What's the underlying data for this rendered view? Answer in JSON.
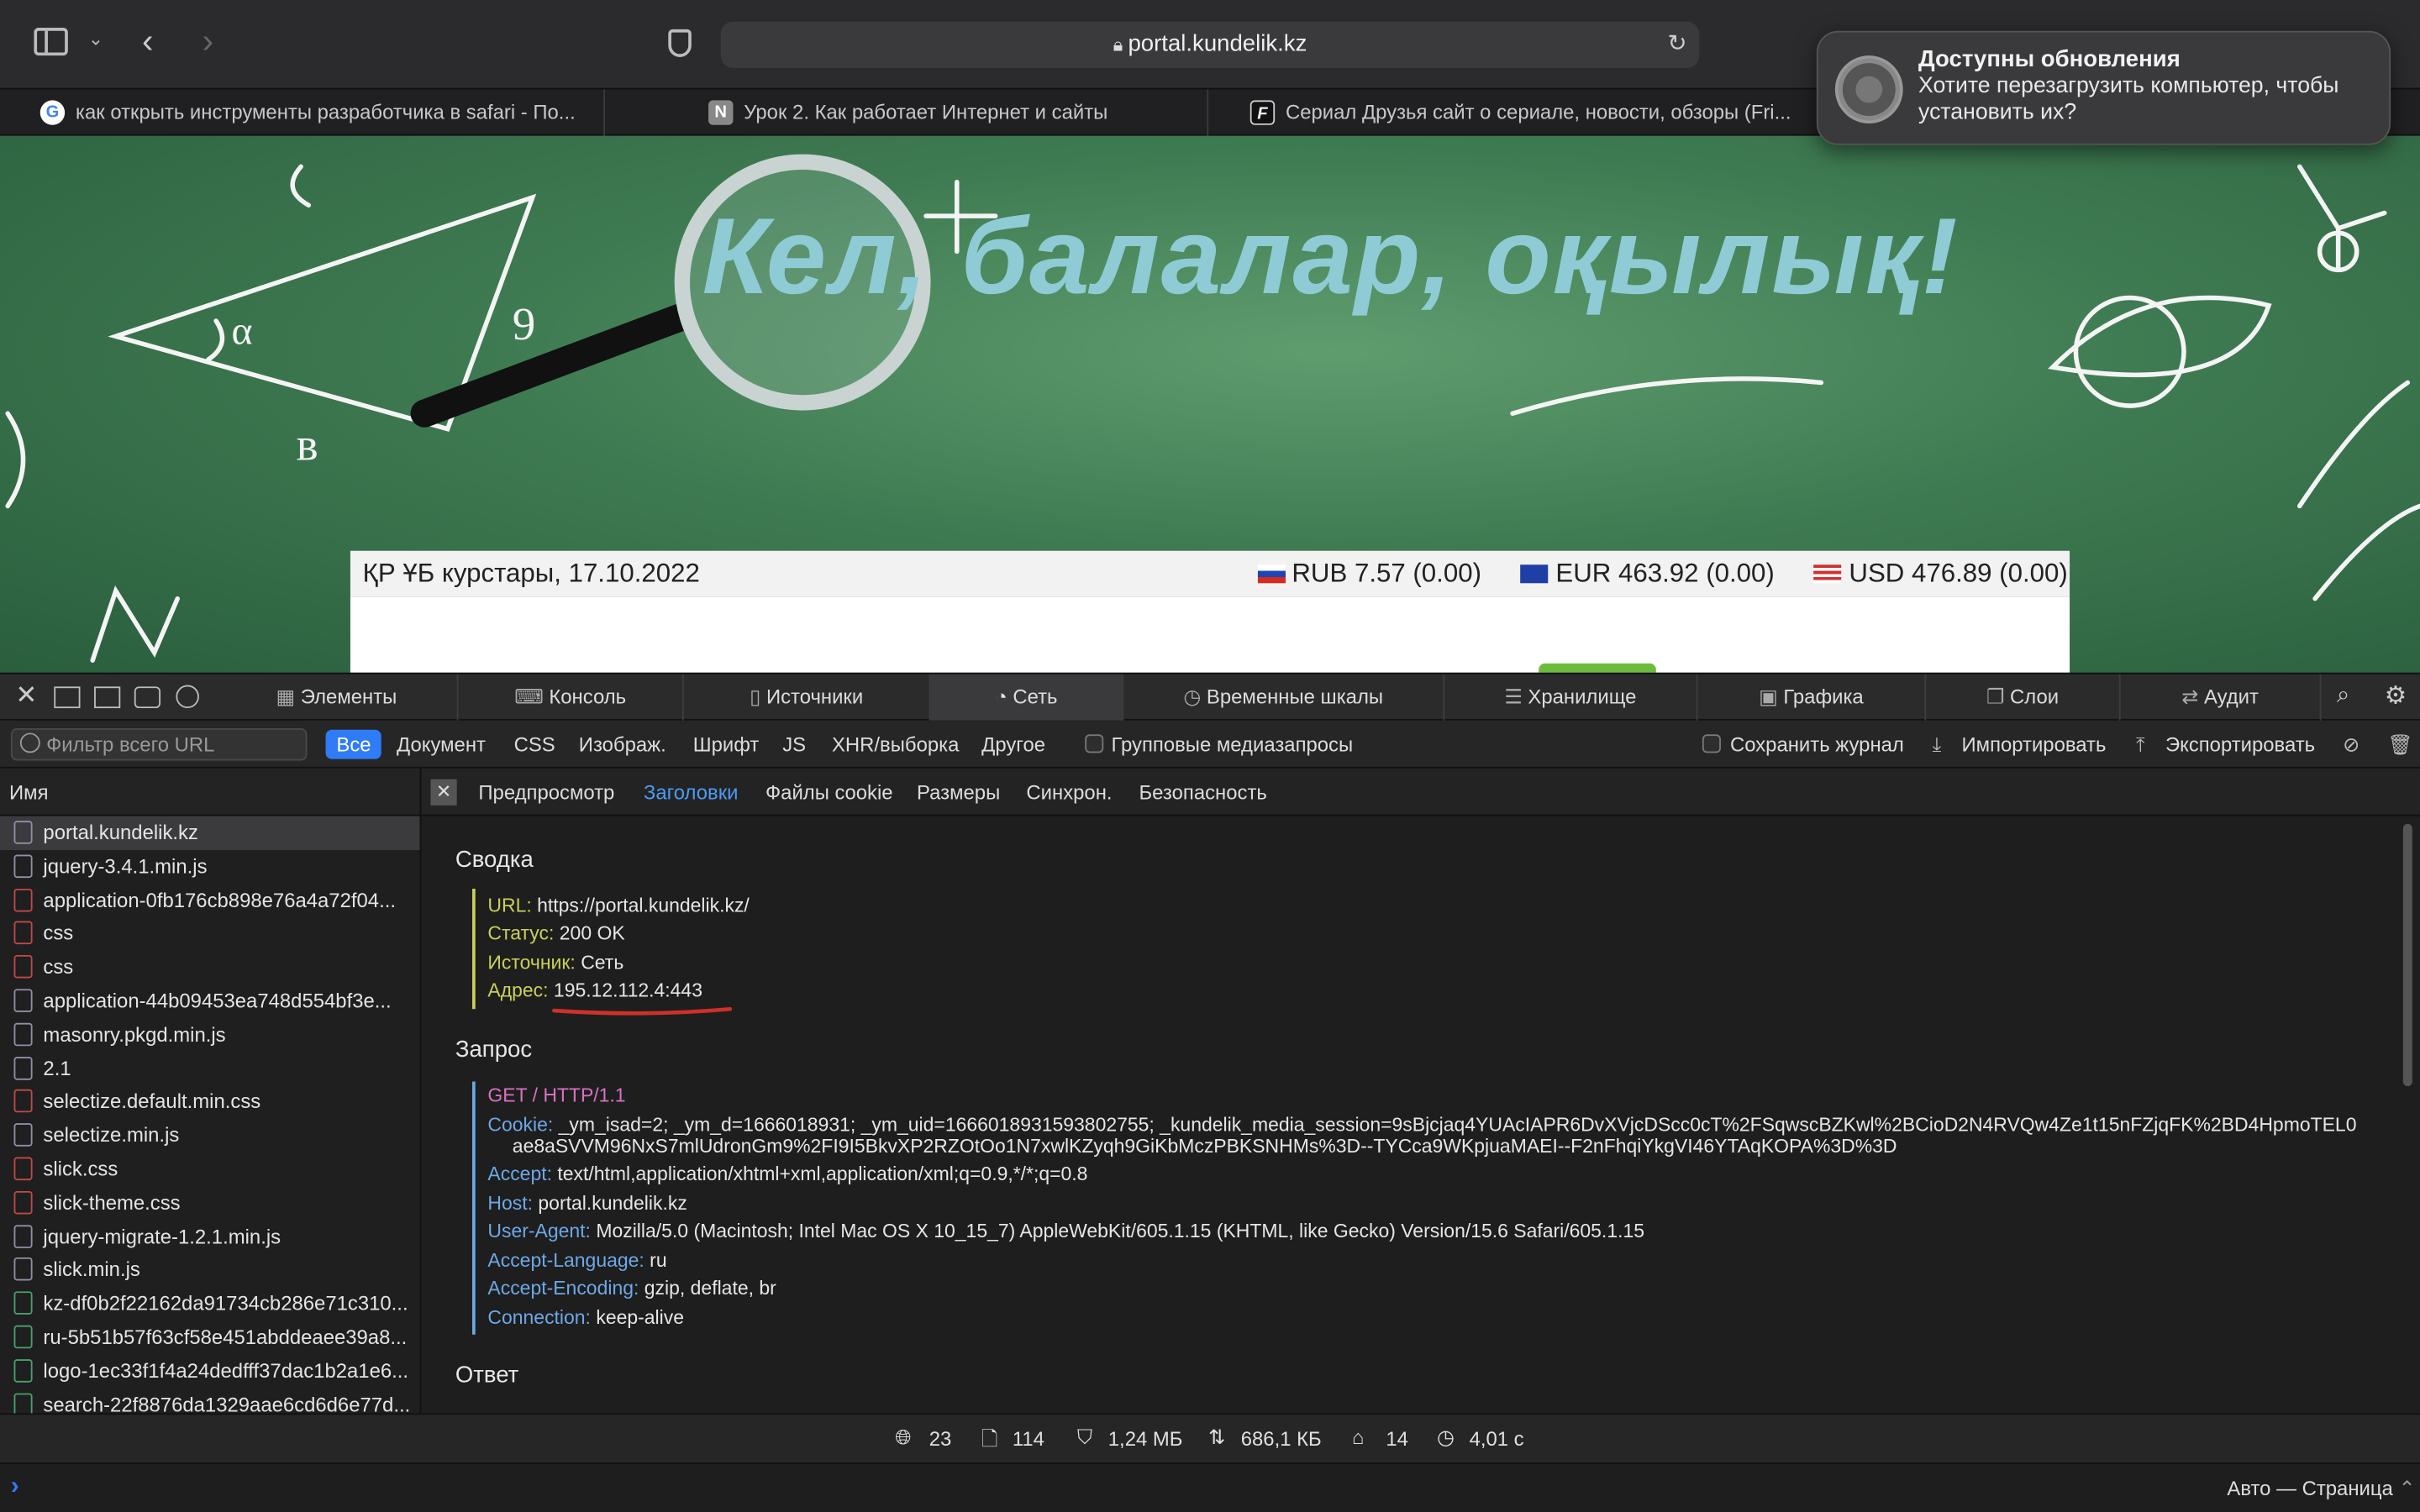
{
  "browser": {
    "url": "portal.kundelik.kz",
    "tabs": [
      {
        "title": "как открыть инструменты разработчика в safari - По...",
        "favicon": "G"
      },
      {
        "title": "Урок 2. Как работает Интернет и сайты",
        "favicon": "N"
      },
      {
        "title": "Сериал Друзья сайт о сериале, новости, обзоры (Fri...",
        "favicon": "F"
      }
    ]
  },
  "notification": {
    "title": "Доступны обновления",
    "body": "Хотите перезагрузить компьютер, чтобы установить их?",
    "icon": "gear-icon"
  },
  "page": {
    "banner_text": "Кел, балалар, оқылық!",
    "rates_title": "ҚР ҰБ курстары, 17.10.2022",
    "rates": [
      {
        "flag": "ru",
        "text": "RUB 7.57 (0.00)"
      },
      {
        "flag": "eu",
        "text": "EUR 463.92 (0.00)"
      },
      {
        "flag": "us",
        "text": "USD 476.89 (0.00)"
      }
    ]
  },
  "devtools": {
    "tabs": [
      {
        "label": "Элементы",
        "icon": "elements-icon"
      },
      {
        "label": "Консоль",
        "icon": "console-icon"
      },
      {
        "label": "Источники",
        "icon": "sources-icon"
      },
      {
        "label": "Сеть",
        "icon": "network-icon",
        "active": true
      },
      {
        "label": "Временные шкалы",
        "icon": "timelines-icon"
      },
      {
        "label": "Хранилище",
        "icon": "storage-icon"
      },
      {
        "label": "Графика",
        "icon": "graphics-icon"
      },
      {
        "label": "Слои",
        "icon": "layers-icon"
      },
      {
        "label": "Аудит",
        "icon": "audit-icon"
      }
    ],
    "filter_placeholder": "Фильтр всего URL",
    "types": [
      "Все",
      "Документ",
      "CSS",
      "Изображ.",
      "Шрифт",
      "JS",
      "XHR/выборка",
      "Другое"
    ],
    "group_media": "Групповые медиазапросы",
    "preserve_log": "Сохранить журнал",
    "import": "Импортировать",
    "export": "Экспортировать",
    "name_header": "Имя",
    "files": [
      {
        "name": "portal.kundelik.kz",
        "type": "doc"
      },
      {
        "name": "jquery-3.4.1.min.js",
        "type": "JS"
      },
      {
        "name": "application-0fb176cb898e76a4a72f04...",
        "type": "CSS"
      },
      {
        "name": "css",
        "type": "CSS"
      },
      {
        "name": "css",
        "type": "CSS"
      },
      {
        "name": "application-44b09453ea748d554bf3e...",
        "type": "JS"
      },
      {
        "name": "masonry.pkgd.min.js",
        "type": "JS"
      },
      {
        "name": "2.1",
        "type": "JS"
      },
      {
        "name": "selectize.default.min.css",
        "type": "CSS"
      },
      {
        "name": "selectize.min.js",
        "type": "JS"
      },
      {
        "name": "slick.css",
        "type": "CSS"
      },
      {
        "name": "slick-theme.css",
        "type": "CSS"
      },
      {
        "name": "jquery-migrate-1.2.1.min.js",
        "type": "JS"
      },
      {
        "name": "slick.min.js",
        "type": "JS"
      },
      {
        "name": "kz-df0b2f22162da91734cb286e71c310...",
        "type": "IMG"
      },
      {
        "name": "ru-5b51b57f63cf58e451abddeaee39a8...",
        "type": "IMG"
      },
      {
        "name": "logo-1ec33f1f4a24dedfff37dac1b2a1e6...",
        "type": "IMG"
      },
      {
        "name": "search-22f8876da1329aae6cd6d6e77d...",
        "type": "IMG"
      }
    ],
    "detail_tabs": [
      "Предпросмотр",
      "Заголовки",
      "Файлы cookie",
      "Размеры",
      "Синхрон.",
      "Безопасность"
    ],
    "summary": {
      "title": "Сводка",
      "items": [
        {
          "k": "URL:",
          "v": "https://portal.kundelik.kz/"
        },
        {
          "k": "Статус:",
          "v": "200 OK"
        },
        {
          "k": "Источник:",
          "v": "Сеть"
        },
        {
          "k": "Адрес:",
          "v": "195.12.112.4:443"
        }
      ]
    },
    "request": {
      "title": "Запрос",
      "method": "GET / HTTP/1.1",
      "items": [
        {
          "k": "Cookie:",
          "v": "_ym_isad=2; _ym_d=1666018931; _ym_uid=1666018931593802755; _kundelik_media_session=9sBjcjaq4YUAcIAPR6DvXVjcDScc0cT%2FSqwscBZKwl%2BCioD2N4RVQw4Ze1t15nFZjqFK%2BD4HpmoTEL0",
          "v2": "ae8aSVVM96NxS7mlUdronGm9%2FI9I5BkvXP2RZOtOo1N7xwlKZyqh9GiKbMczPBKSNHMs%3D--TYCca9WKpjuaMAEI--F2nFhqiYkgVI46YTAqKOPA%3D%3D"
        },
        {
          "k": "Accept:",
          "v": "text/html,application/xhtml+xml,application/xml;q=0.9,*/*;q=0.8"
        },
        {
          "k": "Host:",
          "v": "portal.kundelik.kz"
        },
        {
          "k": "User-Agent:",
          "v": "Mozilla/5.0 (Macintosh; Intel Mac OS X 10_15_7) AppleWebKit/605.1.15 (KHTML, like Gecko) Version/15.6 Safari/605.1.15"
        },
        {
          "k": "Accept-Language:",
          "v": "ru"
        },
        {
          "k": "Accept-Encoding:",
          "v": "gzip, deflate, br"
        },
        {
          "k": "Connection:",
          "v": "keep-alive"
        }
      ]
    },
    "response_title": "Ответ",
    "status": [
      {
        "icon": "globe-icon",
        "v": "23"
      },
      {
        "icon": "document-icon",
        "v": "114"
      },
      {
        "icon": "weight-icon",
        "v": "1,24 МБ"
      },
      {
        "icon": "transfer-icon",
        "v": "686,1 КБ"
      },
      {
        "icon": "cache-icon",
        "v": "14"
      },
      {
        "icon": "clock-icon",
        "v": "4,01 с"
      }
    ],
    "console_mode": "Авто — Страница"
  },
  "colors": {
    "accent": "#2f7cf6",
    "key_green": "#c8d05a",
    "key_blue": "#6da8e8",
    "method": "#d872c3"
  }
}
